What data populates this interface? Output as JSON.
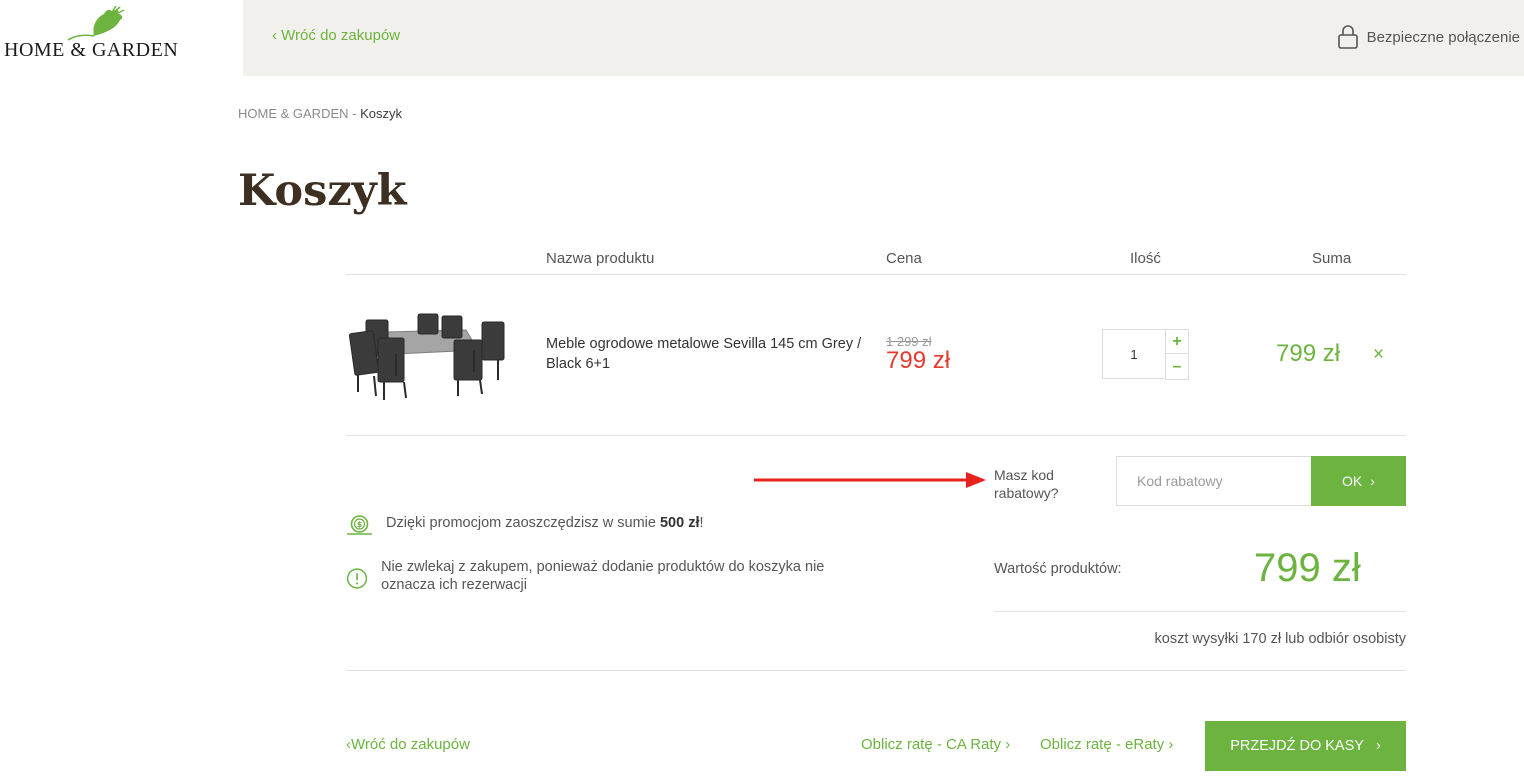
{
  "header": {
    "logo_text": "HOME & GARDEN",
    "back_link": "Wróć do zakupów",
    "secure_label": "Bezpieczne połączenie"
  },
  "breadcrumb": {
    "root": "HOME & GARDEN",
    "separator": "-",
    "current": "Koszyk"
  },
  "page_title": "Koszyk",
  "table": {
    "col_name": "Nazwa produktu",
    "col_price": "Cena",
    "col_qty": "Ilość",
    "col_sum": "Suma"
  },
  "item": {
    "name": "Meble ogrodowe metalowe Sevilla 145 cm Grey / Black 6+1",
    "old_price": "1 299 zł",
    "price": "799 zł",
    "quantity": "1",
    "sum": "799 zł",
    "remove_symbol": "×"
  },
  "discount": {
    "label": "Masz kod rabatowy?",
    "placeholder": "Kod rabatowy",
    "ok_label": "OK"
  },
  "info": {
    "savings_prefix": "Dzięki promocjom zaoszczędzisz w sumie",
    "savings_amount": "500 zł",
    "savings_suffix": "!",
    "warning": "Nie zwlekaj z zakupem, ponieważ dodanie produktów do koszyka nie oznacza ich rezerwacji"
  },
  "totals": {
    "label": "Wartość produktów:",
    "value": "799 zł",
    "shipping": "koszt wysyłki 170 zł lub odbiór osobisty"
  },
  "footer": {
    "back_link": "Wróć do zakupów",
    "ca_raty": "Oblicz ratę - CA Raty",
    "eraty": "Oblicz ratę - eRaty",
    "checkout": "PRZEJDŹ DO KASY"
  },
  "colors": {
    "accent": "#6cb33f",
    "sale": "#e53a2d",
    "title": "#3d2f22",
    "topbar": "#f2f0ec",
    "annotation_arrow": "#e8211d"
  }
}
